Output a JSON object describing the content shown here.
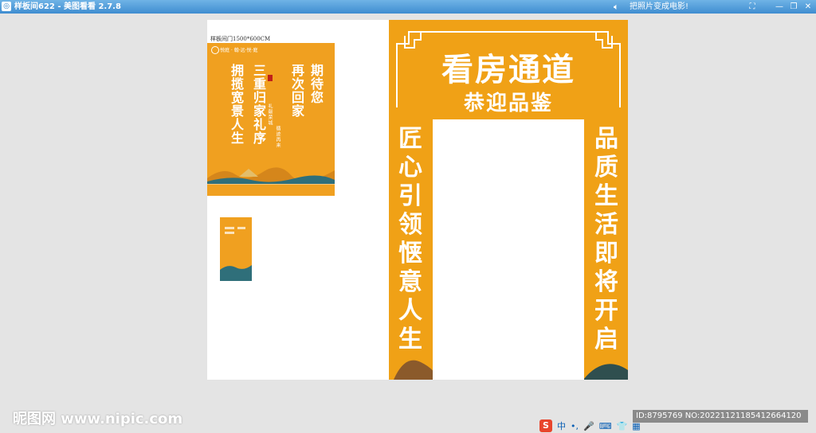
{
  "window": {
    "app_icon": "picture-viewer-icon",
    "title": "样板间622 - 美图看看 2.7.8",
    "promo_text": "把照片变成电影!",
    "controls": [
      "minimize",
      "restore",
      "close"
    ]
  },
  "canvas": {
    "label": "样板间门1500*600CM",
    "poster": {
      "brand": "悦庭 · 翰·远·悦·庭",
      "col_left_1": "拥揽宽景人生",
      "col_left_2": "三重归家礼序",
      "col_right_1": "期待您",
      "col_right_2": "再次回家",
      "tagline_1": "礼献荣城",
      "tagline_2": "循迹再来"
    }
  },
  "gate": {
    "title": "看房通道",
    "subtitle": "恭迎品鉴",
    "left_text": "匠心引领惬意人生",
    "right_text": "品质生活即将开启"
  },
  "footer": {
    "watermark": "昵图网 www.nipic.com",
    "id_text": "ID:8795769 NO:20221121185412664120",
    "ime_items": [
      "S",
      "中",
      "•,",
      "🎤",
      "⌨",
      "👕",
      "▦"
    ]
  },
  "colors": {
    "accent": "#f0a116",
    "titlebar": "#3f8dd0",
    "background": "#e4e4e4"
  }
}
